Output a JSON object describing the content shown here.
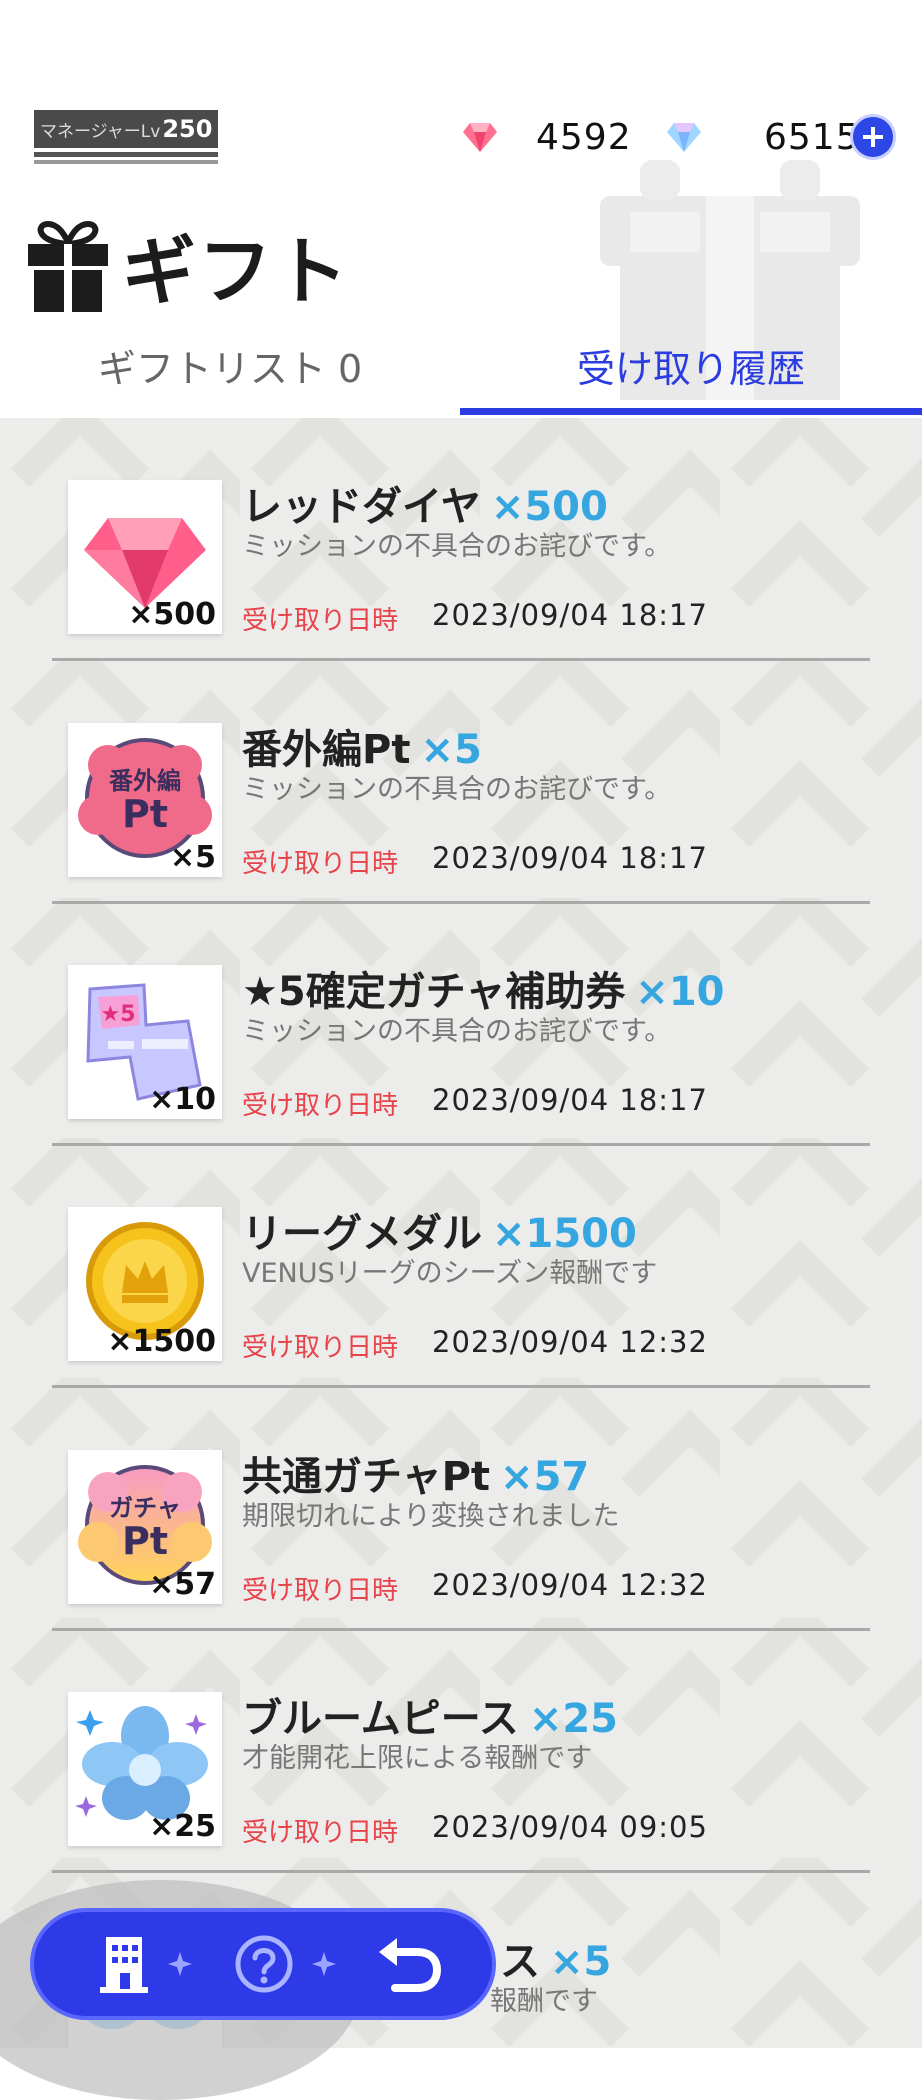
{
  "header": {
    "level_label": "マネージャーLv",
    "level_value": "250",
    "red_diamond_count": "4592",
    "blue_diamond_count": "6515",
    "title": "ギフト"
  },
  "tabs": [
    {
      "label": "ギフトリスト 0",
      "active": false
    },
    {
      "label": "受け取り履歴",
      "active": true
    }
  ],
  "date_label": "受け取り日時",
  "items": [
    {
      "icon": "red-diamond-icon",
      "name": "レッドダイヤ",
      "qty": "×500",
      "thumb_qty": "×500",
      "desc": "ミッションの不具合のお詫びです。",
      "date": "2023/09/04  18:17"
    },
    {
      "icon": "extra-pt-icon",
      "name": "番外編Pt",
      "qty": "×5",
      "thumb_qty": "×5",
      "desc": "ミッションの不具合のお詫びです。",
      "date": "2023/09/04  18:17"
    },
    {
      "icon": "gacha-ticket-icon",
      "name": "★5確定ガチャ補助券",
      "qty": "×10",
      "thumb_qty": "×10",
      "desc": "ミッションの不具合のお詫びです。",
      "date": "2023/09/04  18:17"
    },
    {
      "icon": "league-medal-icon",
      "name": "リーグメダル",
      "qty": "×1500",
      "thumb_qty": "×1500",
      "desc": "VENUSリーグのシーズン報酬です",
      "date": "2023/09/04  12:32"
    },
    {
      "icon": "gacha-pt-icon",
      "name": "共通ガチャPt",
      "qty": "×57",
      "thumb_qty": "×57",
      "desc": "期限切れにより変換されました",
      "date": "2023/09/04  12:32"
    },
    {
      "icon": "bloom-piece-icon",
      "name": "ブルームピース",
      "qty": "×25",
      "thumb_qty": "×25",
      "desc": "才能開花上限による報酬です",
      "date": "2023/09/04  09:05"
    },
    {
      "icon": "bloom-piece-icon",
      "name": "ス",
      "qty": "×5",
      "thumb_qty": "",
      "desc": "報酬です",
      "date": ""
    }
  ],
  "thumb_text": {
    "extra_pt_top": "番外編",
    "extra_pt_bottom": "Pt",
    "gacha_pt_top": "ガチャ",
    "gacha_pt_bottom": "Pt",
    "ticket_star": "★5"
  },
  "nav": {
    "home_icon": "building-icon",
    "help_icon": "question-icon",
    "back_icon": "back-arrow-icon"
  },
  "colors": {
    "accent_blue": "#2b3de0",
    "qty_blue": "#35a6e0",
    "date_red": "#e8424a"
  }
}
